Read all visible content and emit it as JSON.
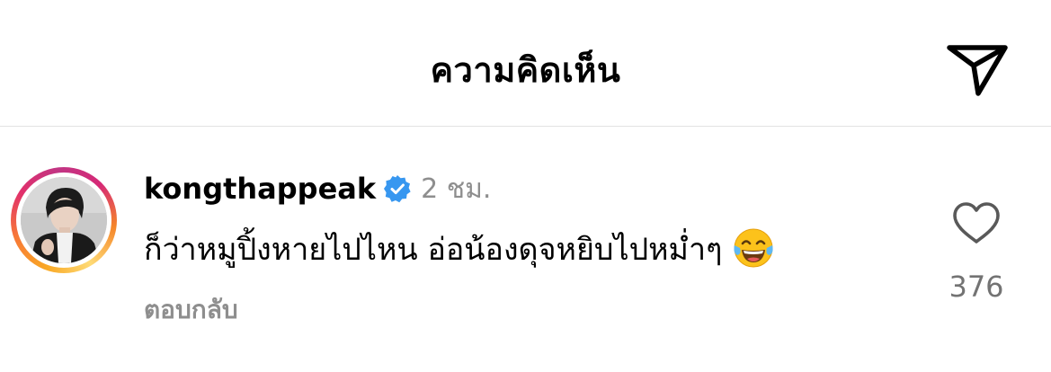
{
  "header": {
    "title": "ความคิดเห็น",
    "share_icon": "paper-plane-icon"
  },
  "comment": {
    "username": "kongthappeak",
    "verified": true,
    "verified_icon": "verified-badge-icon",
    "time": "2 ชม.",
    "text": "ก็ว่าหมูปิ้งหายไปไหน อ่อน้องดุจหยิบไปหม่ำๆ",
    "emoji_icon": "tears-of-joy-emoji-icon",
    "reply_label": "ตอบกลับ",
    "like_icon": "heart-outline-icon",
    "like_count": "376"
  },
  "colors": {
    "verified_blue": "#3797f0",
    "secondary_text": "#8e8e8e",
    "divider": "#e3e3e3"
  }
}
